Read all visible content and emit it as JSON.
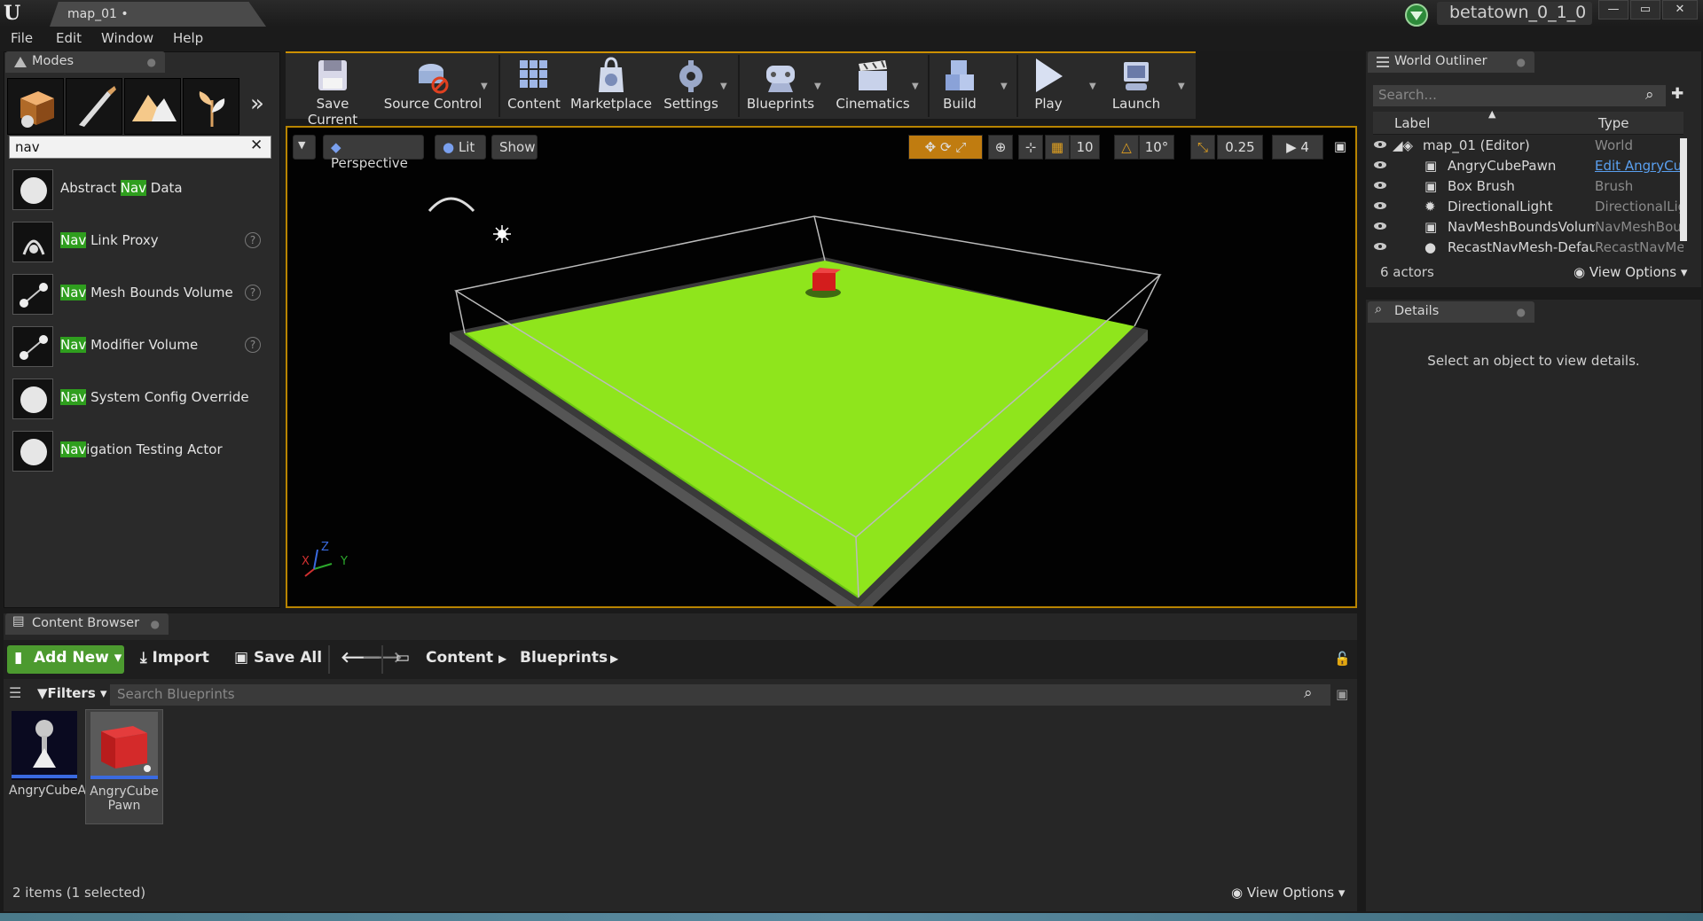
{
  "titlebar": {
    "doc_tab": "map_01 •",
    "project": "betatown_0_1_0",
    "min": "—",
    "max": "▭",
    "close": "✕"
  },
  "menu": [
    "File",
    "Edit",
    "Window",
    "Help"
  ],
  "modes": {
    "title": "Modes",
    "search_value": "nav",
    "clear": "✕",
    "items": [
      {
        "hl": "Nav",
        "rest": " Data",
        "pre": "Abstract "
      },
      {
        "hl": "Nav",
        "rest": " Link Proxy",
        "pre": ""
      },
      {
        "hl": "Nav",
        "rest": " Mesh Bounds Volume",
        "pre": ""
      },
      {
        "hl": "Nav",
        "rest": " Modifier Volume",
        "pre": ""
      },
      {
        "hl": "Nav",
        "rest": " System Config Override",
        "pre": ""
      },
      {
        "hl": "Nav",
        "rest": "igation Testing Actor",
        "pre": ""
      }
    ],
    "help": "?",
    "more": "»"
  },
  "toolbar": [
    "Save Current",
    "Source Control",
    "Content",
    "Marketplace",
    "Settings",
    "Blueprints",
    "Cinematics",
    "Build",
    "Play",
    "Launch"
  ],
  "viewport": {
    "menu_btn": "▼",
    "perspective": "Perspective",
    "lit": "Lit",
    "show": "Show",
    "grid_snap": "10",
    "rot_snap": "10°",
    "scale_snap": "0.25",
    "cam_speed": "4",
    "axis_x": "X",
    "axis_y": "Y",
    "axis_z": "Z"
  },
  "outliner": {
    "title": "World Outliner",
    "search_placeholder": "Search...",
    "col_label": "Label",
    "col_type": "Type",
    "rows": [
      {
        "label": "map_01 (Editor)",
        "type": "World"
      },
      {
        "label": "AngryCubePawn",
        "type": "Edit AngryCu"
      },
      {
        "label": "Box Brush",
        "type": "Brush"
      },
      {
        "label": "DirectionalLight",
        "type": "DirectionalLig"
      },
      {
        "label": "NavMeshBoundsVolum",
        "type": "NavMeshBou"
      },
      {
        "label": "RecastNavMesh-Defaul",
        "type": "RecastNavMe"
      }
    ],
    "count": "6 actors",
    "view_options": "View Options"
  },
  "details": {
    "title": "Details",
    "empty": "Select an object to view details."
  },
  "content_browser": {
    "title": "Content Browser",
    "add_new": "Add New",
    "import": "Import",
    "save_all": "Save All",
    "path": [
      "Content",
      "Blueprints"
    ],
    "filters": "Filters",
    "search_placeholder": "Search Blueprints",
    "assets": [
      {
        "name": "AngryCubeAI"
      },
      {
        "name": "AngryCube Pawn"
      }
    ],
    "status": "2 items (1 selected)",
    "view_options": "View Options"
  },
  "colors": {
    "accent": "#cc9000",
    "nav_highlight": "#2f9e1e",
    "floor": "#8fe51c",
    "add_new": "#4c9a2f"
  }
}
